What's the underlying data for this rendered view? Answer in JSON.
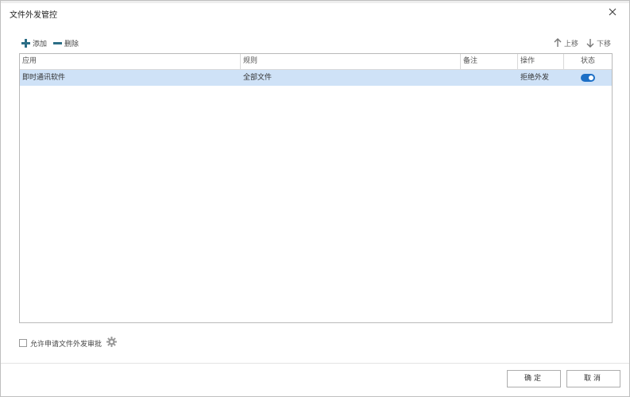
{
  "dialog": {
    "title": "文件外发管控"
  },
  "toolbar": {
    "add_label": "添加",
    "delete_label": "删除",
    "move_up_label": "上移",
    "move_down_label": "下移"
  },
  "table": {
    "columns": [
      "应用",
      "规则",
      "备注",
      "操作",
      "状态"
    ],
    "rows": [
      {
        "app": "即时通讯软件",
        "rule": "全部文件",
        "note": "",
        "action": "拒绝外发",
        "status_enabled": true
      }
    ]
  },
  "footer": {
    "allow_request_label": "允许申请文件外发审批",
    "allow_request_checked": false,
    "ok_label": "确定",
    "cancel_label": "取消"
  },
  "colors": {
    "selected_row": "#cfe2f7",
    "toggle_on": "#1c6fc6",
    "toolbar_icon": "#2c6e86"
  }
}
